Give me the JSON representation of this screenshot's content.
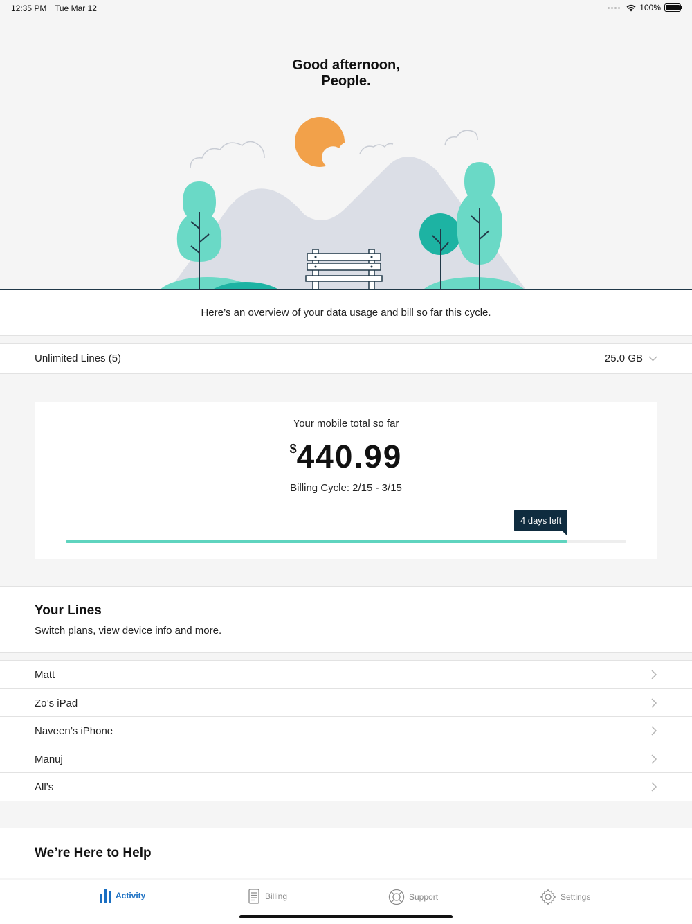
{
  "status_bar": {
    "time": "12:35 PM",
    "date": "Tue Mar 12",
    "battery": "100%",
    "icons": [
      "signal-dots-icon",
      "wifi-icon",
      "battery-icon"
    ]
  },
  "greeting": {
    "line1": "Good afternoon,",
    "line2": "People."
  },
  "colors": {
    "accent": "#5fd4bf",
    "tree_teal": "#6ad9c6",
    "tree_dark_teal": "#1db3a3",
    "sun": "#f2a14a",
    "mountain": "#dbdee6",
    "navy": "#0f2c3f",
    "tab_active": "#1a6fc2"
  },
  "overview": {
    "text": "Here’s an overview of your data usage and bill so far this cycle."
  },
  "plan": {
    "name": "Unlimited Lines (5)",
    "data": "25.0 GB"
  },
  "bill": {
    "label": "Your mobile total so far",
    "currency": "$",
    "amount": "440.99",
    "cycle": "Billing Cycle: 2/15 - 3/15",
    "days_left": "4 days left",
    "cycle_progress": 0.895
  },
  "lines": {
    "title": "Your Lines",
    "subtitle": "Switch plans, view device info and more.",
    "items": [
      {
        "label": "Matt"
      },
      {
        "label": "Zo’s iPad"
      },
      {
        "label": "Naveen’s iPhone"
      },
      {
        "label": "Manuj"
      },
      {
        "label": "All’s"
      }
    ]
  },
  "help": {
    "title": "We’re Here to Help"
  },
  "tabs": [
    {
      "label": "Activity",
      "icon": "activity-bars-icon",
      "active": true
    },
    {
      "label": "Billing",
      "icon": "billing-document-icon",
      "active": false
    },
    {
      "label": "Support",
      "icon": "support-lifebuoy-icon",
      "active": false
    },
    {
      "label": "Settings",
      "icon": "settings-gear-icon",
      "active": false
    }
  ]
}
